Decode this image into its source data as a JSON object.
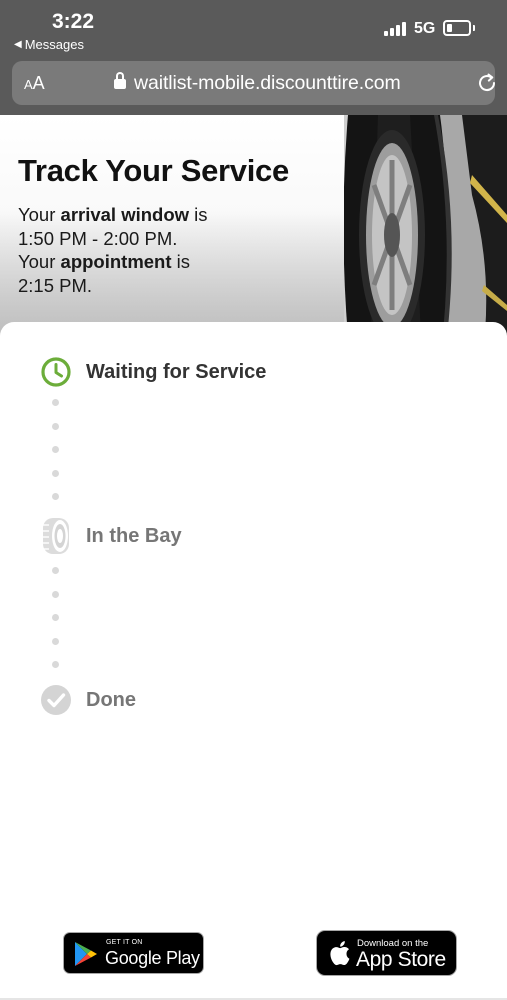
{
  "status_bar": {
    "time": "3:22",
    "back_app": "Messages",
    "network": "5G"
  },
  "browser": {
    "text_size": "AA",
    "url": "waitlist-mobile.discounttire.com"
  },
  "hero": {
    "title": "Track Your Service",
    "arrival_prefix": "Your ",
    "arrival_label": "arrival window",
    "arrival_suffix": " is",
    "arrival_time": "1:50 PM - 2:00 PM.",
    "appt_prefix": "Your ",
    "appt_label": "appointment",
    "appt_suffix": " is",
    "appt_time": "2:15 PM."
  },
  "tracker": {
    "steps": [
      {
        "label": "Waiting for Service",
        "state": "active",
        "icon": "clock-icon"
      },
      {
        "label": "In the Bay",
        "state": "pending",
        "icon": "tire-icon"
      },
      {
        "label": "Done",
        "state": "pending",
        "icon": "checkmark-icon"
      }
    ]
  },
  "badges": {
    "google_small": "GET IT ON",
    "google_big": "Google Play",
    "apple_small": "Download on the",
    "apple_big": "App Store"
  },
  "colors": {
    "active_green": "#6cad3a",
    "inactive_gray": "#d4d4d4",
    "chrome_gray": "#5a5a5a"
  }
}
